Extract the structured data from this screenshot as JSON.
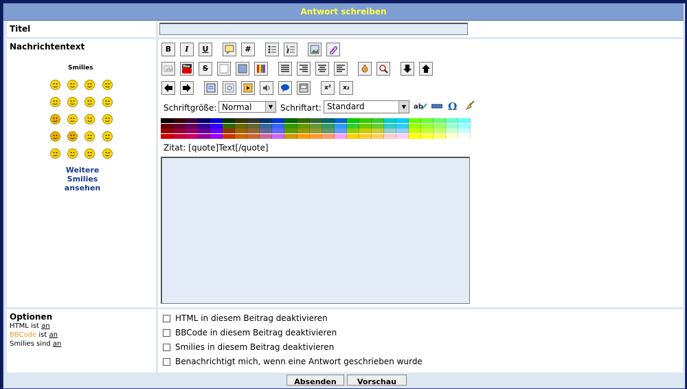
{
  "header": {
    "title": "Antwort schreiben"
  },
  "title_row": {
    "label": "Titel",
    "value": ""
  },
  "message_row": {
    "label": "Nachrichtentext"
  },
  "smilies": {
    "heading": "Smilies",
    "more_line1": "Weitere",
    "more_line2": "Smilies",
    "more_line3": "ansehen",
    "icons": [
      "smile-icon",
      "grin-icon",
      "sad-icon",
      "surprised-icon",
      "eek-icon",
      "neutral-icon",
      "cool-icon",
      "laugh-icon",
      "wink-icon",
      "razz-icon",
      "confused-icon",
      "frown-icon",
      "evil-icon",
      "twisted-icon",
      "rolleyes-icon",
      "happy-icon",
      "exclaim-icon",
      "question-icon",
      "idea-icon",
      "arrow-icon"
    ]
  },
  "toolbar": {
    "bold": "B",
    "italic": "I",
    "underline": "U",
    "hash": "#",
    "strike": "S",
    "superscript": "x²",
    "subscript": "x₂"
  },
  "font_controls": {
    "size_label": "Schriftgröße:",
    "size_value": "Normal",
    "font_label": "Schriftart:",
    "font_value": "Standard"
  },
  "quote_hint": "Zitat: [quote]Text[/quote]",
  "message_text": "",
  "options": {
    "label": "Optionen",
    "html_prefix": "HTML ist ",
    "html_state": "an",
    "bbcode_prefix": "BBCode",
    "bbcode_mid": " ist ",
    "bbcode_state": "an",
    "smilies_prefix": "Smilies sind ",
    "smilies_state": "an",
    "checkbox_1": "HTML in diesem Beitrag deaktivieren",
    "checkbox_2": "BBCode in diesem Beitrag deaktivieren",
    "checkbox_3": "Smilies in diesem Beitrag deaktivieren",
    "checkbox_4": "Benachrichtigt mich, wenn eine Antwort geschrieben wurde"
  },
  "buttons": {
    "submit": "Absenden",
    "preview": "Vorschau"
  },
  "colors": {
    "header_bg": "#7f9ed2",
    "header_text": "#ffff44",
    "link_blue": "#1a3a8a",
    "bbcode_orange": "#e8a030"
  }
}
